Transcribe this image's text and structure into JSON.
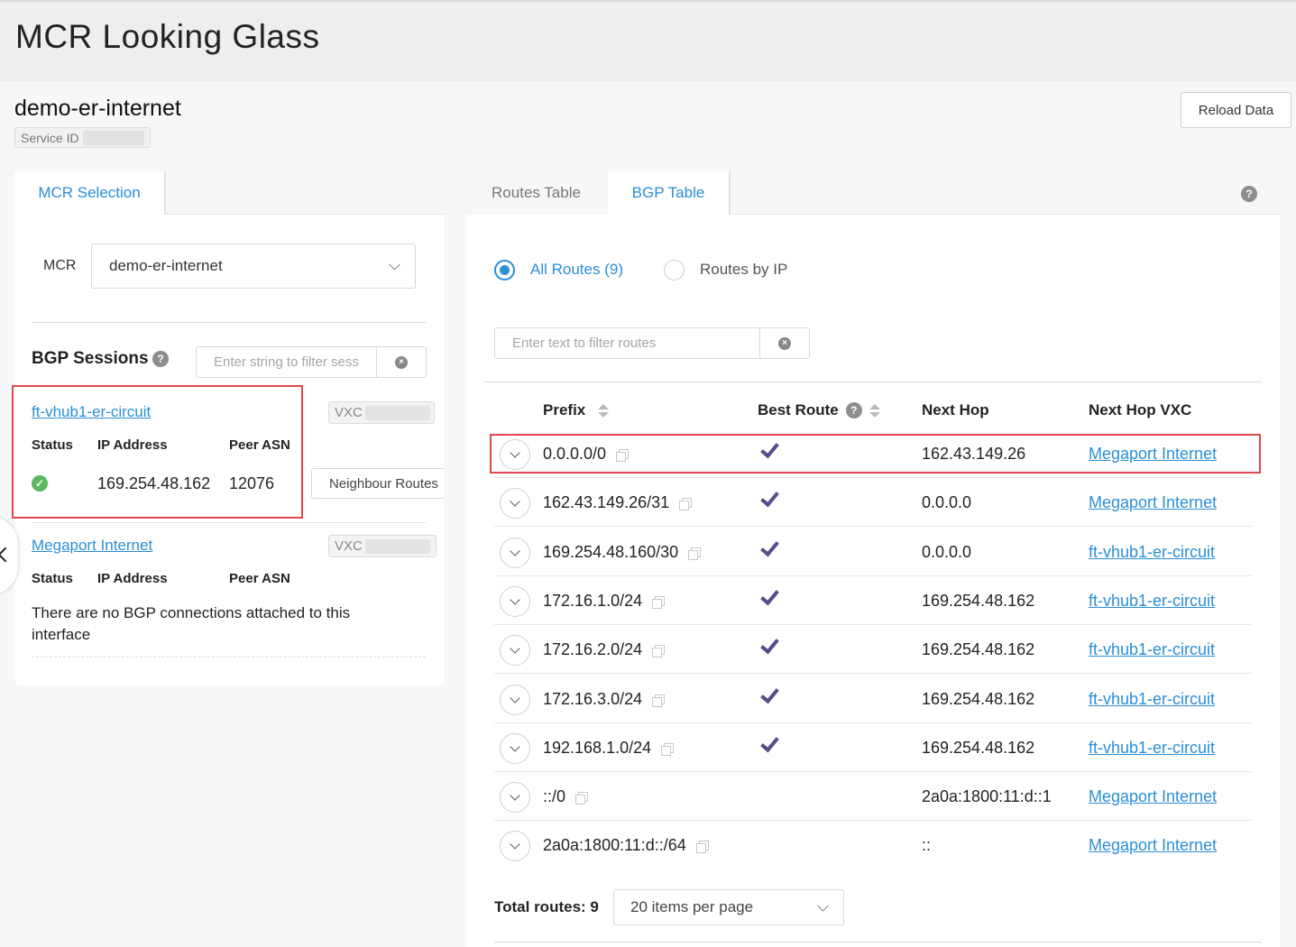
{
  "app": {
    "title": "MCR Looking Glass"
  },
  "service": {
    "name": "demo-er-internet",
    "id_label": "Service ID",
    "reload_label": "Reload Data"
  },
  "left": {
    "tab_label": "MCR Selection",
    "mcr_label": "MCR",
    "mcr_value": "demo-er-internet",
    "bgp_title": "BGP Sessions",
    "filter_placeholder": "Enter string to filter sess",
    "sessions": [
      {
        "name": "ft-vhub1-er-circuit",
        "vxc_label": "VXC",
        "headers": {
          "status": "Status",
          "ip": "IP Address",
          "asn": "Peer ASN"
        },
        "ip": "169.254.48.162",
        "asn": "12076",
        "status": "up",
        "neighbour_label": "Neighbour Routes"
      },
      {
        "name": "Megaport Internet",
        "vxc_label": "VXC",
        "headers": {
          "status": "Status",
          "ip": "IP Address",
          "asn": "Peer ASN"
        },
        "empty_message": "There are no BGP connections attached to this interface"
      }
    ]
  },
  "right": {
    "tabs": [
      {
        "label": "Routes Table"
      },
      {
        "label": "BGP Table"
      }
    ],
    "radios": [
      {
        "label": "All Routes (9)",
        "selected": true
      },
      {
        "label": "Routes by IP",
        "selected": false
      }
    ],
    "filter_placeholder": "Enter text to filter routes",
    "columns": {
      "prefix": "Prefix",
      "best": "Best Route",
      "hop": "Next Hop",
      "vxc": "Next Hop VXC"
    },
    "rows": [
      {
        "prefix": "0.0.0.0/0",
        "best": true,
        "hop": "162.43.149.26",
        "vxc": "Megaport Internet"
      },
      {
        "prefix": "162.43.149.26/31",
        "best": true,
        "hop": "0.0.0.0",
        "vxc": "Megaport Internet"
      },
      {
        "prefix": "169.254.48.160/30",
        "best": true,
        "hop": "0.0.0.0",
        "vxc": "ft-vhub1-er-circuit"
      },
      {
        "prefix": "172.16.1.0/24",
        "best": true,
        "hop": "169.254.48.162",
        "vxc": "ft-vhub1-er-circuit"
      },
      {
        "prefix": "172.16.2.0/24",
        "best": true,
        "hop": "169.254.48.162",
        "vxc": "ft-vhub1-er-circuit"
      },
      {
        "prefix": "172.16.3.0/24",
        "best": true,
        "hop": "169.254.48.162",
        "vxc": "ft-vhub1-er-circuit"
      },
      {
        "prefix": "192.168.1.0/24",
        "best": true,
        "hop": "169.254.48.162",
        "vxc": "ft-vhub1-er-circuit"
      },
      {
        "prefix": "::/0",
        "best": false,
        "hop": "2a0a:1800:11:d::1",
        "vxc": "Megaport Internet"
      },
      {
        "prefix": "2a0a:1800:11:d::/64",
        "best": false,
        "hop": "::",
        "vxc": "Megaport Internet"
      }
    ],
    "total_label": "Total routes: 9",
    "per_page": "20 items per page"
  },
  "colors": {
    "accent": "#2a8fd6",
    "highlight": "#e0474c",
    "check": "#5b4a8a",
    "ok": "#5cb85c"
  }
}
